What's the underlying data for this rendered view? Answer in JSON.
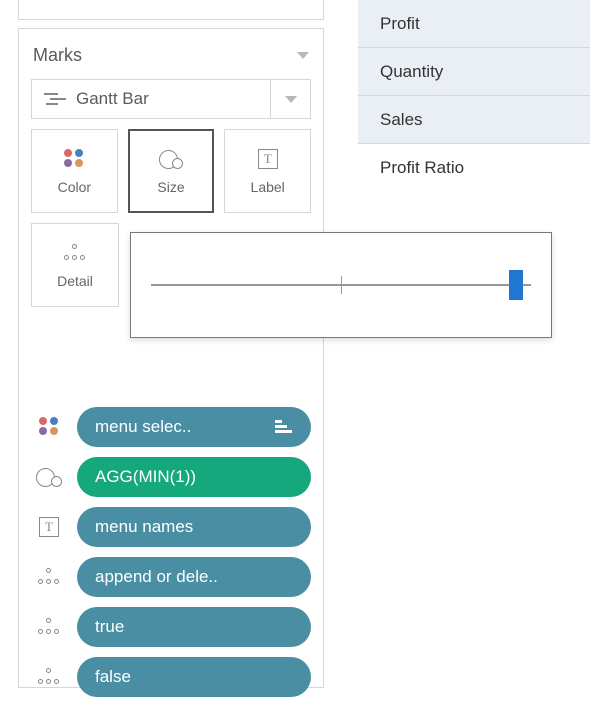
{
  "marksCard": {
    "title": "Marks",
    "markType": "Gantt Bar",
    "shelves": {
      "color": "Color",
      "size": "Size",
      "label": "Label",
      "detail": "Detail"
    }
  },
  "pills": [
    {
      "icon": "color",
      "label": "menu selec..",
      "sort": true,
      "color": "teal"
    },
    {
      "icon": "size",
      "label": "AGG(MIN(1))",
      "sort": false,
      "color": "green"
    },
    {
      "icon": "label",
      "label": "menu names",
      "sort": false,
      "color": "teal"
    },
    {
      "icon": "detail",
      "label": "append or dele..",
      "sort": false,
      "color": "teal"
    },
    {
      "icon": "detail",
      "label": "true",
      "sort": false,
      "color": "teal"
    },
    {
      "icon": "detail",
      "label": "false",
      "sort": false,
      "color": "teal"
    }
  ],
  "slider": {
    "valuePercent": 96
  },
  "measures": {
    "items": [
      "Profit",
      "Quantity",
      "Sales"
    ],
    "calc": "Profit Ratio"
  }
}
